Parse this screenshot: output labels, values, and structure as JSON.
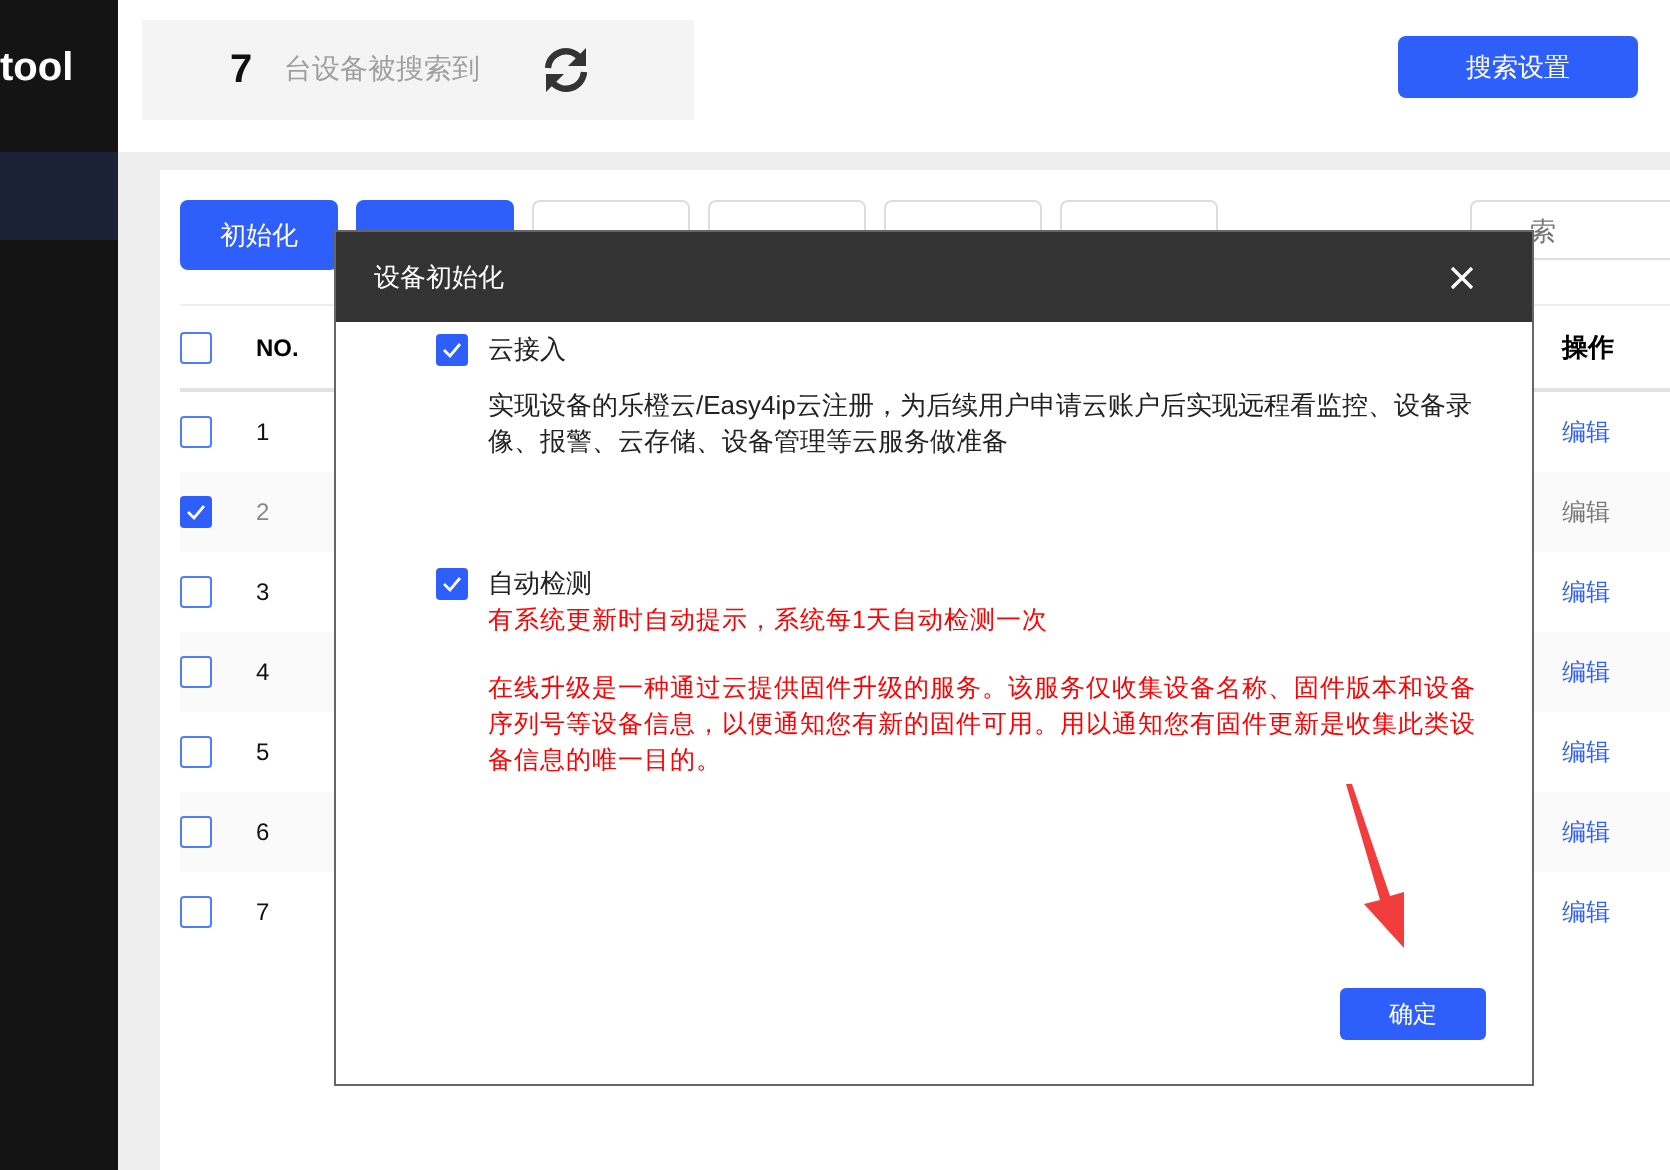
{
  "sidebar": {
    "app_title": "tool",
    "items": [
      {
        "selected": true
      }
    ]
  },
  "search_summary": {
    "count": "7",
    "label": "台设备被搜索到"
  },
  "search_settings_button": "搜索设置",
  "toolbar": {
    "buttons": [
      {
        "label": "初始化",
        "kind": "primary"
      },
      {
        "kind": "primary"
      },
      {
        "kind": "outline"
      },
      {
        "kind": "outline"
      },
      {
        "kind": "outline"
      },
      {
        "kind": "outline"
      }
    ],
    "search": {
      "placeholder": "索"
    }
  },
  "table": {
    "header_checked": false,
    "columns": [
      "NO.",
      "操作"
    ],
    "rows": [
      {
        "no": "1",
        "selected": false,
        "action": "编辑"
      },
      {
        "no": "2",
        "selected": true,
        "action": "编辑"
      },
      {
        "no": "3",
        "selected": false,
        "action": "编辑"
      },
      {
        "no": "4",
        "selected": false,
        "action": "编辑"
      },
      {
        "no": "5",
        "selected": false,
        "action": "编辑"
      },
      {
        "no": "6",
        "selected": false,
        "action": "编辑"
      },
      {
        "no": "7",
        "selected": false,
        "action": "编辑"
      }
    ]
  },
  "dialog": {
    "title": "设备初始化",
    "options": [
      {
        "label": "云接入",
        "checked": true,
        "description": "实现设备的乐橙云/Easy4ip云注册，为后续用户申请云账户后实现远程看监控、设备录像、报警、云存储、设备管理等云服务做准备"
      },
      {
        "label": "自动检测",
        "checked": true,
        "notes": [
          "有系统更新时自动提示，系统每1天自动检测一次",
          "在线升级是一种通过云提供固件升级的服务。该服务仅收集设备名称、固件版本和设备序列号等设备信息，以便通知您有新的固件可用。用以通知您有固件更新是收集此类设备信息的唯一目的。"
        ]
      }
    ],
    "confirm_button": "确定"
  }
}
